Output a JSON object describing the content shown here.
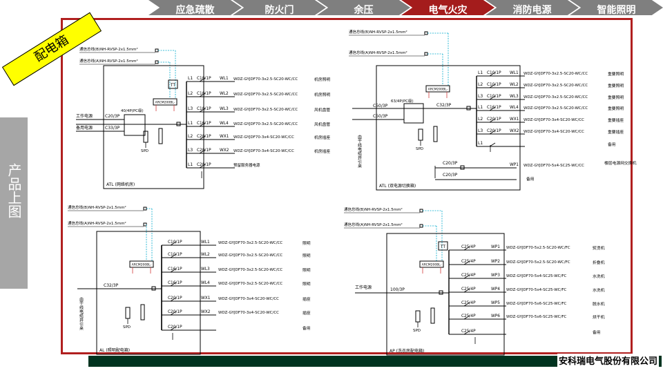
{
  "tabs": [
    {
      "label": "应急疏散",
      "active": false
    },
    {
      "label": "防火门",
      "active": false
    },
    {
      "label": "余压",
      "active": false
    },
    {
      "label": "电气火灾",
      "active": true
    },
    {
      "label": "消防电源",
      "active": false
    },
    {
      "label": "智能照明",
      "active": false
    }
  ],
  "badge": "配电箱",
  "side_title": "产品上图",
  "company": "安科瑞电气股份有限公司",
  "colors": {
    "accent_red": "#a41c1c",
    "tab_gray": "#7f7f7f",
    "footer_green": "#00331f",
    "badge_yellow": "#ffff00",
    "bus_cyan": "#00aacc"
  },
  "diagrams": [
    {
      "comm_top": "通信总线(B)NH-RVSP-2x1.5mm²",
      "comm_bottom": "通信总线(A)NH-RVSP-2x1.5mm²",
      "box_label": "ATL (网络机房)",
      "sources": [
        "工作电源",
        "备用电源"
      ],
      "incoming": [
        "C20/3P",
        "C33/3P"
      ],
      "ats": "40/4P(PC级)",
      "meter": "ARCM200BL-",
      "spd": "SPD",
      "tt": "TT",
      "branches": [
        {
          "phase": "L1",
          "breaker": "C10/1P",
          "id": "WL1",
          "cable": "WDZ-GYJDF70-3x2.5-SC20-WC/CC",
          "load": "机房照明"
        },
        {
          "phase": "L2",
          "breaker": "C10/1P",
          "id": "WL2",
          "cable": "WDZ-GYJDF70-3x2.5-SC20-WC/CC",
          "load": "机房照明"
        },
        {
          "phase": "L3",
          "breaker": "C10/1P",
          "id": "WL3",
          "cable": "WDZ-GYJDF70-3x2.5-SC20-WC/CC",
          "load": "风机盘管"
        },
        {
          "phase": "L1",
          "breaker": "C16/1P",
          "id": "WL4",
          "cable": "WDZ-GYJDF70-3x2.5-SC20-WC/CC",
          "load": "风机盘管"
        },
        {
          "phase": "L2",
          "breaker": "C20/1P",
          "id": "WX1",
          "cable": "WDZ-GYJDF70-3x4-SC20-WC/CC",
          "load": "机房插座"
        },
        {
          "phase": "L3",
          "breaker": "C20/1P",
          "id": "WX2",
          "cable": "WDZ-GYJDF70-3x4-SC20-WC/CC",
          "load": "机房插座"
        },
        {
          "phase": "L1",
          "breaker": "C20/1P",
          "id": "",
          "cable": "预留服务器电源",
          "load": ""
        }
      ]
    },
    {
      "comm_top": "通信总线(B)NH-RVSP-2x1.5mm²",
      "comm_bottom": "通信总线(A)NH-RVSP-2x1.5mm²",
      "box_label": "ATL (双电源切换箱)",
      "side_label": "由干线电缆井引来",
      "incoming": [
        "C50/3P",
        "C50/3P"
      ],
      "ats": "63/4P(PC级)",
      "main": "C32/3P",
      "meter": "ARCM200BL-",
      "spd": "SPD",
      "aux_breakers": [
        "C20/3P",
        "C20/3P"
      ],
      "branches": [
        {
          "phase": "L1",
          "breaker": "C10/1P",
          "id": "WL1",
          "cable": "WDZ-GYJDF70-3x2.5-SC20-WC/CC",
          "load": "重要照明"
        },
        {
          "phase": "L2",
          "breaker": "C10/1P",
          "id": "WL2",
          "cable": "WDZ-GYJDF70-3x2.5-SC20-WC/CC",
          "load": "重要照明"
        },
        {
          "phase": "L3",
          "breaker": "C10/1P",
          "id": "WL3",
          "cable": "WDZ-GYJDF70-3x2.5-SC20-WC/CC",
          "load": "重要照明"
        },
        {
          "phase": "L1",
          "breaker": "C16/1P",
          "id": "WL4",
          "cable": "WDZ-GYJDF70-3x2.5-SC20-WC/CC",
          "load": "重要照明"
        },
        {
          "phase": "L2",
          "breaker": "C20/1P",
          "id": "WX1",
          "cable": "WDZ-GYJDF70-3x4-SC20-WC/CC",
          "load": "重要插座"
        },
        {
          "phase": "L3",
          "breaker": "C20/1P",
          "id": "WX2",
          "cable": "WDZ-GYJDF70-3x4-SC20-WC/CC",
          "load": "重要插座"
        },
        {
          "phase": "L1",
          "breaker": "",
          "id": "",
          "cable": "",
          "load": "备用"
        }
      ],
      "extra": [
        {
          "id": "WP1",
          "cable": "WDZ-GYJDF70-5x4-SC25-WC/CC",
          "load": "楼层电源网交换机"
        },
        {
          "id": "",
          "cable": "",
          "load": "备用"
        }
      ]
    },
    {
      "comm_top": "通信总线(B)NH-RVSP-2x1.5mm²",
      "comm_bottom": "通信总线(A)NH-RVSP-2x1.5mm²",
      "box_label": "AL (照明配电箱)",
      "side_label": "由干线电缆井引来",
      "main": "C32/3P",
      "meter": "ARCM200BL-",
      "spd": "SPD",
      "branches": [
        {
          "breaker": "C10/1P",
          "id": "WL1",
          "cable": "WDZ-GYJDF70-3x2.5-SC20-WC/CC",
          "load": "照明"
        },
        {
          "breaker": "C10/1P",
          "id": "WL2",
          "cable": "WDZ-GYJDF70-3x2.5-SC20-WC/CC",
          "load": "照明"
        },
        {
          "breaker": "C16/1P",
          "id": "WL3",
          "cable": "WDZ-GYJDF70-3x2.5-SC20-WC/CC",
          "load": "照明"
        },
        {
          "breaker": "C16/1P",
          "id": "WL4",
          "cable": "WDZ-GYJDF70-3x2.5-SC20-WC/CC",
          "load": "照明"
        },
        {
          "breaker": "C20/1P",
          "id": "WX1",
          "cable": "WDZ-GYJDF70-3x4-SC20-WC/CC",
          "load": "插座"
        },
        {
          "breaker": "C20/1P",
          "id": "WX2",
          "cable": "WDZ-GYJDF70-3x4-SC20-WC/CC",
          "load": "插座"
        },
        {
          "breaker": "C20/1P",
          "id": "",
          "cable": "",
          "load": "备用"
        }
      ]
    },
    {
      "comm_top": "通信总线(B)NH-RVSP-2x1.5mm²",
      "comm_bottom": "通信总线(A)NH-RVSP-2x1.5mm²",
      "box_label": "AP (洗衣房配电箱)",
      "source": "工作电源",
      "main": "100/3P",
      "meter": "ARCM200BL-",
      "spd": "SPD",
      "tt": "TT",
      "branches": [
        {
          "breaker": "C25/4P",
          "id": "WP1",
          "cable": "WDZ-GYJDF70-5x2.5-SC20-WC/FC",
          "load": "熨烫机"
        },
        {
          "breaker": "C25/4P",
          "id": "WP2",
          "cable": "WDZ-GYJDF70-5x2.5-SC20-WC/FC",
          "load": "折叠机"
        },
        {
          "breaker": "C25/4P",
          "id": "WP3",
          "cable": "WDZ-GYJDF70-5x4-SC25-WC/FC",
          "load": "水洗机"
        },
        {
          "breaker": "C25/4P",
          "id": "WP4",
          "cable": "WDZ-GYJDF70-5x4-SC25-WC/FC",
          "load": "水洗机"
        },
        {
          "breaker": "C25/4P",
          "id": "WP5",
          "cable": "WDZ-GYJDF70-5x6-SC25-WC/FC",
          "load": "脱水机"
        },
        {
          "breaker": "C25/4P",
          "id": "WP6",
          "cable": "WDZ-GYJDF70-5x6-SC25-WC/FC",
          "load": "烘干机"
        },
        {
          "breaker": "C25/4P",
          "id": "",
          "cable": "",
          "load": "备用"
        }
      ]
    }
  ]
}
